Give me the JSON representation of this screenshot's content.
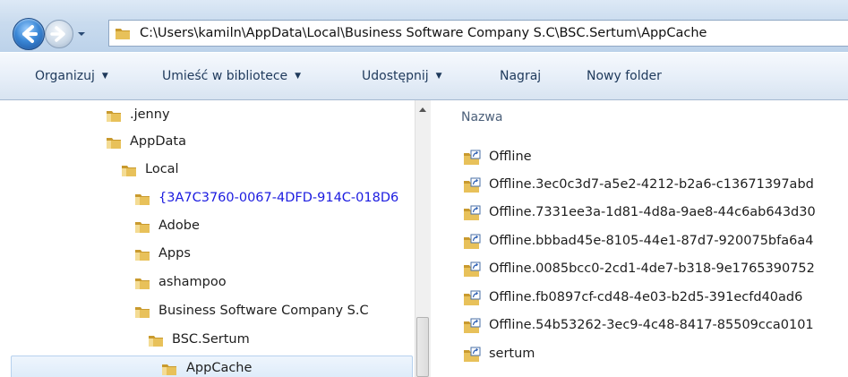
{
  "address": {
    "path": "C:\\Users\\kamiln\\AppData\\Local\\Business Software Company S.C\\BSC.Sertum\\AppCache"
  },
  "toolbar": {
    "items": [
      {
        "label": "Organizuj",
        "dropdown": true
      },
      {
        "label": "Umieść w bibliotece",
        "dropdown": true
      },
      {
        "label": "Udostępnij",
        "dropdown": true
      },
      {
        "label": "Nagraj",
        "dropdown": false
      },
      {
        "label": "Nowy folder",
        "dropdown": false
      }
    ],
    "caret": "▼"
  },
  "nav_tree": [
    {
      "label": ".jenny",
      "highlight": false,
      "selected": false
    },
    {
      "label": "AppData",
      "highlight": false,
      "selected": false
    },
    {
      "label": "Local",
      "highlight": false,
      "selected": false
    },
    {
      "label": "{3A7C3760-0067-4DFD-914C-018D6",
      "highlight": true,
      "selected": false
    },
    {
      "label": "Adobe",
      "highlight": false,
      "selected": false
    },
    {
      "label": "Apps",
      "highlight": false,
      "selected": false
    },
    {
      "label": "ashampoo",
      "highlight": false,
      "selected": false
    },
    {
      "label": "Business Software Company S.C",
      "highlight": false,
      "selected": false
    },
    {
      "label": "BSC.Sertum",
      "highlight": false,
      "selected": false
    },
    {
      "label": "AppCache",
      "highlight": false,
      "selected": true
    }
  ],
  "content": {
    "column_header": "Nazwa",
    "items": [
      {
        "label": "Offline"
      },
      {
        "label": "Offline.3ec0c3d7-a5e2-4212-b2a6-c13671397abd"
      },
      {
        "label": "Offline.7331ee3a-1d81-4d8a-9ae8-44c6ab643d30"
      },
      {
        "label": "Offline.bbbad45e-8105-44e1-87d7-920075bfa6a4"
      },
      {
        "label": "Offline.0085bcc0-2cd1-4de7-b318-9e1765390752"
      },
      {
        "label": "Offline.fb0897cf-cd48-4e03-b2d5-391ecfd40ad6"
      },
      {
        "label": "Offline.54b53262-3ec9-4c48-8417-85509cca0101"
      },
      {
        "label": "sertum"
      }
    ]
  },
  "colors": {
    "folder": "#e8c15a",
    "folder_dark": "#c99a2e",
    "tree_highlight_text": "#1b1be0",
    "toolbar_text": "#1e395b"
  }
}
